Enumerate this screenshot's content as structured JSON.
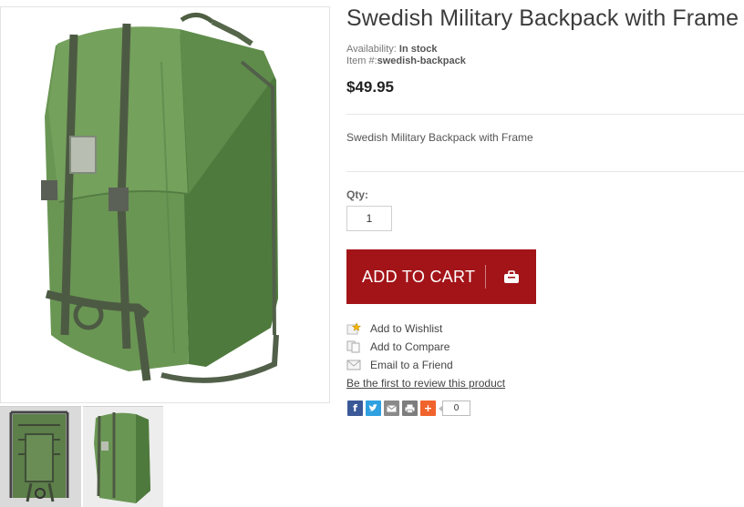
{
  "product": {
    "title": "Swedish Military Backpack with Frame",
    "availability_label": "Availability:",
    "availability_value": "In stock",
    "item_label": "Item #:",
    "item_value": "swedish-backpack",
    "price": "$49.95",
    "short_description": "Swedish Military Backpack with Frame"
  },
  "qty": {
    "label": "Qty:",
    "value": "1"
  },
  "cart": {
    "button_label": "ADD TO CART",
    "icon": "shopping-bag-icon",
    "color": "#a31418"
  },
  "actions": {
    "wishlist": "Add to Wishlist",
    "compare": "Add to Compare",
    "email": "Email to a Friend",
    "review": "Be the first to review this product"
  },
  "share": {
    "facebook_glyph": "f",
    "plus_glyph": "+",
    "count": "0"
  },
  "gallery": {
    "main_image": "green-backpack-photo",
    "thumbnails": [
      "backpack-frame-rear-thumbnail",
      "backpack-front-thumbnail"
    ],
    "pack_color": "#5f8a4a"
  }
}
